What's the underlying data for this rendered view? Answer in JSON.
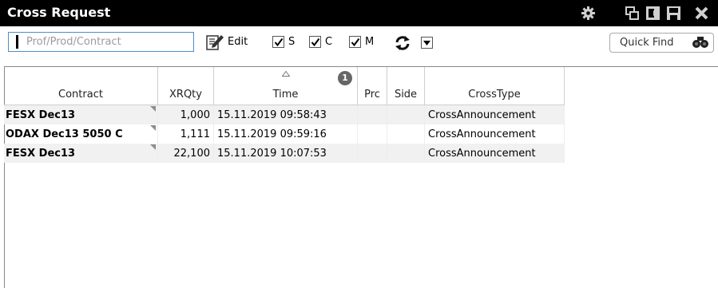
{
  "window": {
    "title": "Cross Request",
    "controls": [
      "gear-icon",
      "restore-window-icon",
      "detach-window-icon",
      "save-window-icon",
      "close-icon"
    ]
  },
  "toolbar": {
    "search_placeholder": "Prof/Prod/Contract",
    "search_value": "",
    "edit_label": "Edit",
    "checkboxes": [
      {
        "label": "S",
        "checked": true
      },
      {
        "label": "C",
        "checked": true
      },
      {
        "label": "M",
        "checked": true
      }
    ],
    "quick_find_label": "Quick Find"
  },
  "table": {
    "columns": [
      "Contract",
      "XRQty",
      "Time",
      "Prc",
      "Side",
      "CrossType"
    ],
    "sort_column": "Time",
    "sort_badge": "1",
    "rows": [
      {
        "contract": "FESX Dec13",
        "xrqty": "1,000",
        "time": "15.11.2019 09:58:43",
        "prc": "",
        "side": "",
        "crosstype": "CrossAnnouncement"
      },
      {
        "contract": "ODAX Dec13 5050 C",
        "xrqty": "1,111",
        "time": "15.11.2019 09:59:16",
        "prc": "",
        "side": "",
        "crosstype": "CrossAnnouncement"
      },
      {
        "contract": "FESX Dec13",
        "xrqty": "22,100",
        "time": "15.11.2019 10:07:53",
        "prc": "",
        "side": "",
        "crosstype": "CrossAnnouncement"
      }
    ]
  },
  "colors": {
    "titlebar_bg": "#000000",
    "search_border": "#4d8ec9",
    "row_stripe": "#f1f1f1"
  }
}
